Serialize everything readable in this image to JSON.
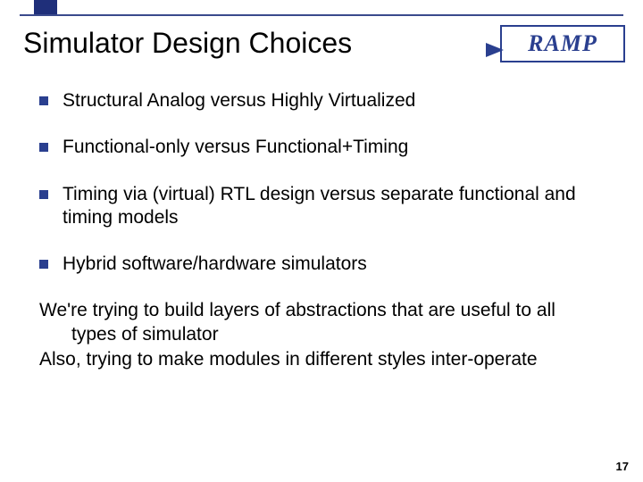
{
  "logo": {
    "text": "RAMP"
  },
  "title": "Simulator Design Choices",
  "bullets": [
    "Structural Analog versus Highly Virtualized",
    "Functional-only versus Functional+Timing",
    "Timing via (virtual) RTL design versus separate functional and timing models",
    "Hybrid software/hardware simulators"
  ],
  "paragraphs": [
    "We're trying to build layers of abstractions that are useful to all types of simulator",
    "Also, trying to make modules in different styles inter-operate"
  ],
  "page_number": "17"
}
